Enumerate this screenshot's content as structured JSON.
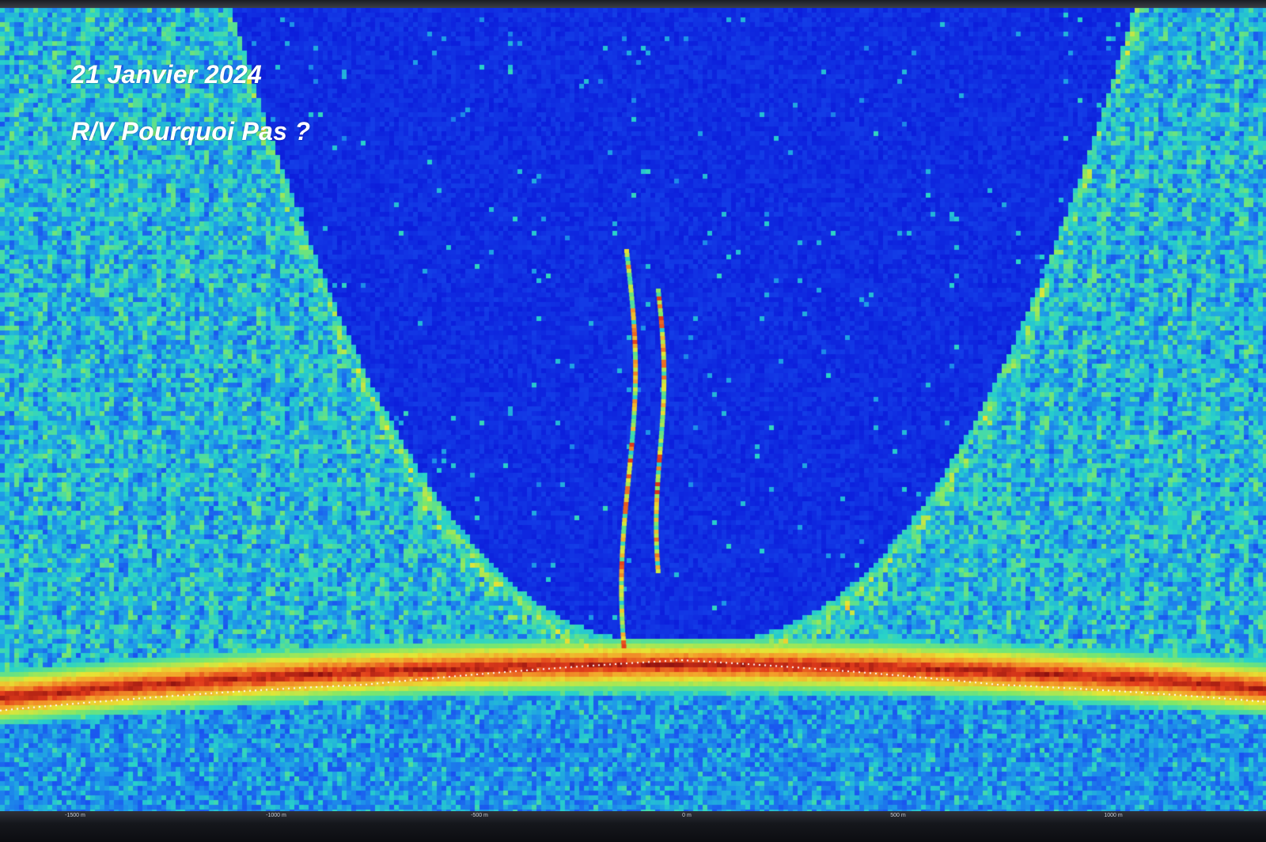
{
  "annotations": {
    "date": "21 Janvier 2024",
    "vessel": "R/V Pourquoi Pas ?"
  },
  "range_axis": {
    "ticks": [
      {
        "label": "-1500 m",
        "value": -1500
      },
      {
        "label": "-1000 m",
        "value": -1000
      },
      {
        "label": "-500 m",
        "value": -500
      },
      {
        "label": "0 m",
        "value": 0
      },
      {
        "label": "500 m",
        "value": 500
      },
      {
        "label": "1000 m",
        "value": 1000
      }
    ]
  },
  "colormap": [
    "#0a14d8",
    "#1a55f0",
    "#1f9be8",
    "#29d3c9",
    "#7ee86a",
    "#e6e635",
    "#f4a12b",
    "#e23d1c",
    "#8c0f0f"
  ],
  "bottom_line_color": "#ffffff"
}
